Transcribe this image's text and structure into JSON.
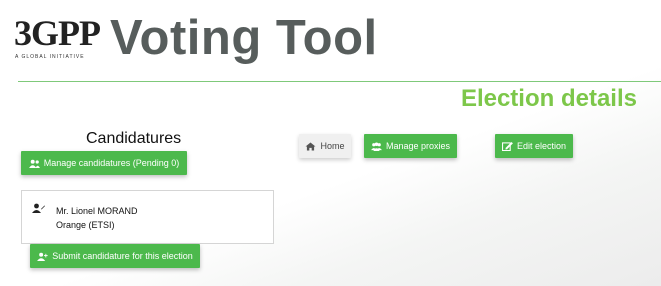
{
  "logo": {
    "text": "3GPP",
    "tagline": "A GLOBAL INITIATIVE"
  },
  "app_title": "Voting Tool",
  "section_title": "Election details",
  "candidatures": {
    "heading": "Candidatures",
    "manage_label": "Manage candidatures (Pending 0)",
    "candidates": [
      {
        "name": "Mr. Lionel MORAND",
        "organization": "Orange (ETSI)"
      }
    ],
    "submit_label": "Submit candidature for this election"
  },
  "actions": {
    "home_label": "Home",
    "manage_proxies_label": "Manage proxies",
    "edit_election_label": "Edit election"
  },
  "colors": {
    "accent_green": "#4cb94c",
    "title_green": "#7dc74a",
    "title_gray": "#575d5c"
  }
}
